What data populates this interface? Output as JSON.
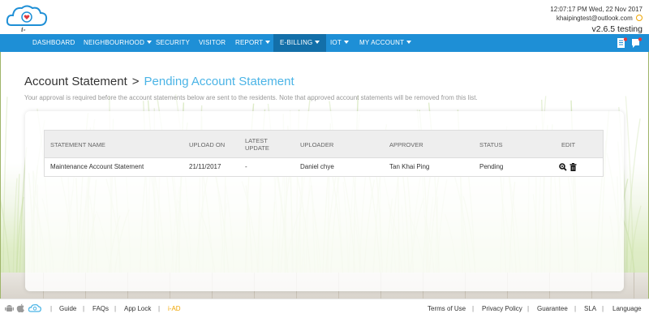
{
  "header": {
    "app_name": "i-Neighbour",
    "datetime": "12:07:17 PM  Wed, 22 Nov 2017",
    "email": "khaipingtest@outlook.com",
    "version": "v2.6.5 testing",
    "colors": {
      "accent": "#1e8fd6",
      "active": "#136fa9",
      "link": "#4bb4e6",
      "power": "#f0a500"
    }
  },
  "nav": {
    "items": [
      {
        "label": "DASHBOARD",
        "dropdown": false,
        "active": false
      },
      {
        "label": "NEIGHBOURHOOD",
        "dropdown": true,
        "active": false
      },
      {
        "label": "SECURITY",
        "dropdown": false,
        "active": false
      },
      {
        "label": "VISITOR",
        "dropdown": false,
        "active": false
      },
      {
        "label": "REPORT",
        "dropdown": true,
        "active": false
      },
      {
        "label": "E-BILLING",
        "dropdown": true,
        "active": true
      },
      {
        "label": "IOT",
        "dropdown": true,
        "active": false
      },
      {
        "label": "MY ACCOUNT",
        "dropdown": true,
        "active": false
      }
    ],
    "right_icons": [
      "document-icon",
      "notification-icon"
    ]
  },
  "page": {
    "breadcrumb_parent": "Account Statement",
    "breadcrumb_sep": ">",
    "breadcrumb_current": "Pending Account Statement",
    "note": "Your approval is required before the account statements below are sent to the residents. Note that approved account statements will be removed from this list."
  },
  "table": {
    "columns": [
      "STATEMENT NAME",
      "UPLOAD ON",
      "LATEST UPDATE",
      "UPLOADER",
      "APPROVER",
      "STATUS",
      "EDIT"
    ],
    "rows": [
      {
        "statement_name": "Maintenance Account Statement",
        "upload_on": "21/11/2017",
        "latest_update": "-",
        "uploader": "Daniel chye",
        "approver": "Tan Khai Ping",
        "status": "Pending",
        "edit_icons": [
          "view-icon",
          "delete-icon"
        ]
      }
    ]
  },
  "footer": {
    "platform_icons": [
      "android-icon",
      "apple-icon",
      "cloud-icon"
    ],
    "left_links": [
      "Guide",
      "FAQs",
      "App Lock",
      "i-AD"
    ],
    "right_links": [
      "Terms of Use",
      "Privacy Policy",
      "Guarantee",
      "SLA",
      "Language"
    ]
  }
}
